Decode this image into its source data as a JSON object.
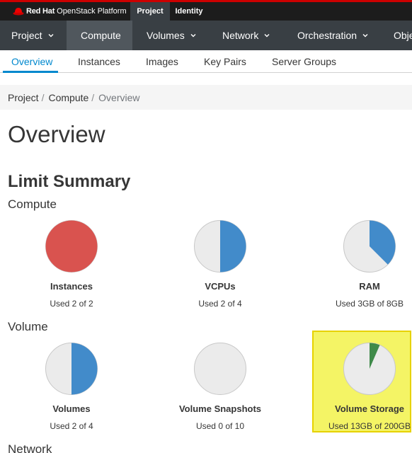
{
  "brand": {
    "name": "Red Hat",
    "product": "OpenStack Platform"
  },
  "top_tabs": [
    {
      "label": "Project",
      "active": true
    },
    {
      "label": "Identity",
      "active": false
    }
  ],
  "main_nav": [
    {
      "label": "Project",
      "has_caret": true
    },
    {
      "label": "Compute",
      "active": true
    },
    {
      "label": "Volumes",
      "has_caret": true
    },
    {
      "label": "Network",
      "has_caret": true
    },
    {
      "label": "Orchestration",
      "has_caret": true
    },
    {
      "label": "Obje"
    }
  ],
  "sub_nav": [
    {
      "label": "Overview",
      "active": true
    },
    {
      "label": "Instances"
    },
    {
      "label": "Images"
    },
    {
      "label": "Key Pairs"
    },
    {
      "label": "Server Groups"
    }
  ],
  "breadcrumb": [
    "Project",
    "Compute",
    "Overview"
  ],
  "page_title": "Overview",
  "limit_summary_title": "Limit Summary",
  "groups": {
    "compute": "Compute",
    "volume": "Volume",
    "network": "Network"
  },
  "charts": [
    {
      "title": "Instances",
      "used_text": "Used 2 of 2",
      "fraction": 1.0,
      "color": "#d9534f"
    },
    {
      "title": "VCPUs",
      "used_text": "Used 2 of 4",
      "fraction": 0.5,
      "color": "#428bca"
    },
    {
      "title": "RAM",
      "used_text": "Used 3GB of 8GB",
      "fraction": 0.375,
      "color": "#428bca"
    },
    {
      "title": "Volumes",
      "used_text": "Used 2 of 4",
      "fraction": 0.5,
      "color": "#428bca"
    },
    {
      "title": "Volume Snapshots",
      "used_text": "Used 0 of 10",
      "fraction": 0.0,
      "color": "#428bca"
    },
    {
      "title": "Volume Storage",
      "used_text": "Used 13GB of 200GB",
      "fraction": 0.065,
      "color": "#3f8a4a"
    }
  ],
  "colors": {
    "accent": "#0088ce",
    "pie_empty": "#ebebeb",
    "highlight": "#f5f53c"
  }
}
